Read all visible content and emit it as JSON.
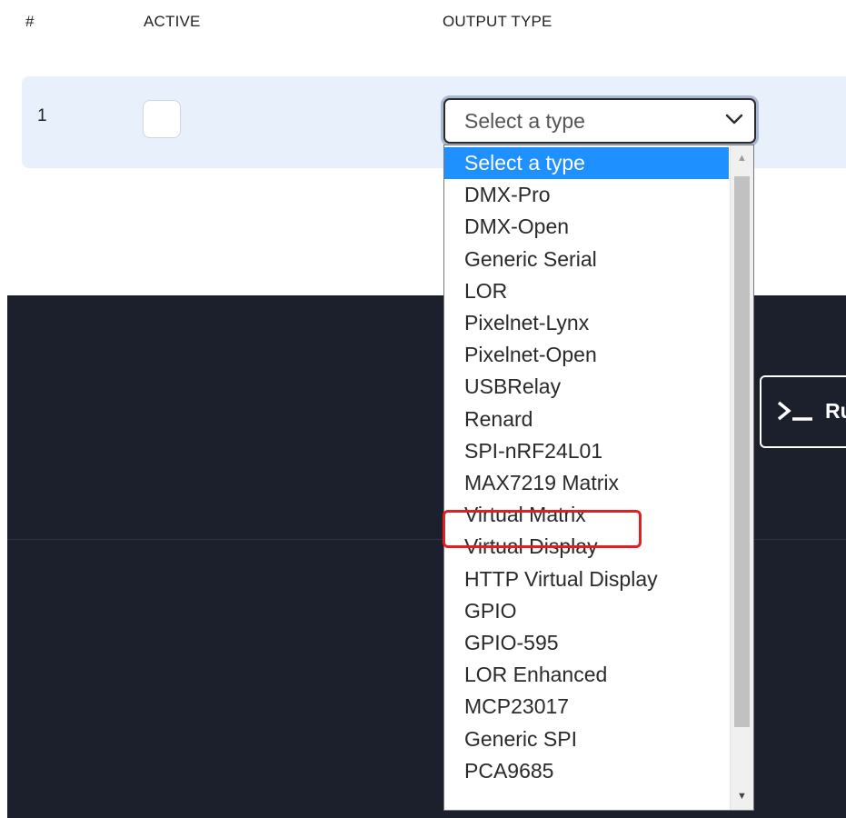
{
  "table": {
    "headers": {
      "num": "#",
      "active": "ACTIVE",
      "output_type": "OUTPUT TYPE"
    },
    "row": {
      "num": "1",
      "active_checked": false,
      "output_type_value": "Select a type"
    }
  },
  "dropdown": {
    "options": [
      "Select a type",
      "DMX-Pro",
      "DMX-Open",
      "Generic Serial",
      "LOR",
      "Pixelnet-Lynx",
      "Pixelnet-Open",
      "USBRelay",
      "Renard",
      "SPI-nRF24L01",
      "MAX7219 Matrix",
      "Virtual Matrix",
      "Virtual Display",
      "HTTP Virtual Display",
      "GPIO",
      "GPIO-595",
      "LOR Enhanced",
      "MCP23017",
      "Generic SPI",
      "PCA9685"
    ],
    "selected_index": 0,
    "highlighted_option": "Virtual Matrix"
  },
  "run_button": {
    "icon": "terminal-icon",
    "label": "Ru"
  },
  "colors": {
    "row_bg": "#e8f0fc",
    "dark_bg": "#1c1f2c",
    "selected_option_bg": "#1e90ff",
    "highlight_border": "#e02020"
  }
}
